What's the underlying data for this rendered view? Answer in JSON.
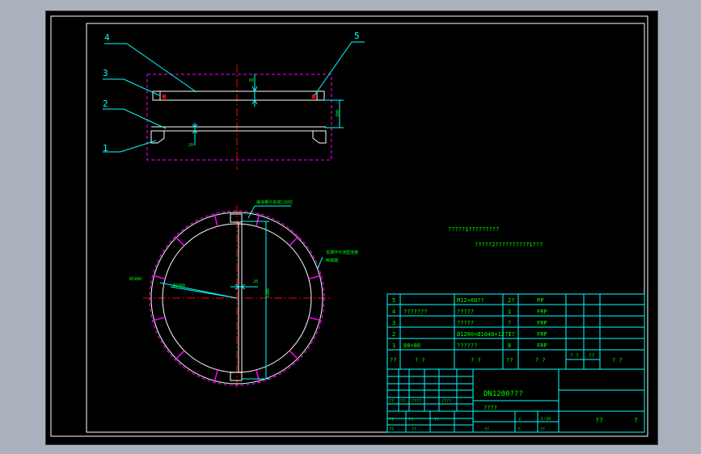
{
  "colors": {
    "background": "#000000",
    "frame": "#ffffff",
    "table": "#00ffff",
    "text": "#00ff00",
    "centerline": "#ff0000",
    "hidden": "#ff00ff"
  },
  "leaders": {
    "p1": "1",
    "p2": "2",
    "p3": "3",
    "p4": "4",
    "p5": "5"
  },
  "dims": {
    "top": "80",
    "side": "300",
    "bottom": "20",
    "outer_d": "Ø1400",
    "inner_d": "Ø1060",
    "center": "20",
    "vertical": "1200"
  },
  "notes": {
    "tag1": "接液槽与进液口对应",
    "tag2a": "支撑环与池壁连接",
    "tag2b": "M8膨胀",
    "n1": "?????1?????????",
    "n2": "?????2??????????1???"
  },
  "parts": {
    "headers": [
      "??",
      "? ?",
      "? ?",
      "??",
      "? ?",
      "? ?"
    ],
    "rows": [
      {
        "no": "5",
        "code": "",
        "name": "M12×60??",
        "qty": "2?",
        "mat": "PP"
      },
      {
        "no": "4",
        "code": "???????",
        "name": "?????",
        "qty": "1",
        "mat": "FRP"
      },
      {
        "no": "3",
        "code": "",
        "name": "?????",
        "qty": "?",
        "mat": "FRP"
      },
      {
        "no": "2",
        "code": "",
        "name": "Ø1200×Ø1040×12???",
        "qty": "1",
        "mat": "FRP"
      },
      {
        "no": "1",
        "code": "80×80",
        "name": "??????",
        "qty": "8",
        "mat": "FRP"
      }
    ],
    "header_extra": "? ?",
    "header_extra2": "??"
  },
  "titleblock": {
    "title": "DN1200???",
    "subtitle": "????",
    "sheet": "??",
    "page": "?",
    "scale": "1:10",
    "labels": [
      "??",
      "??",
      "????",
      "????",
      "??",
      "??",
      "??",
      "??",
      "??",
      "??",
      "?",
      "??",
      "?"
    ]
  }
}
